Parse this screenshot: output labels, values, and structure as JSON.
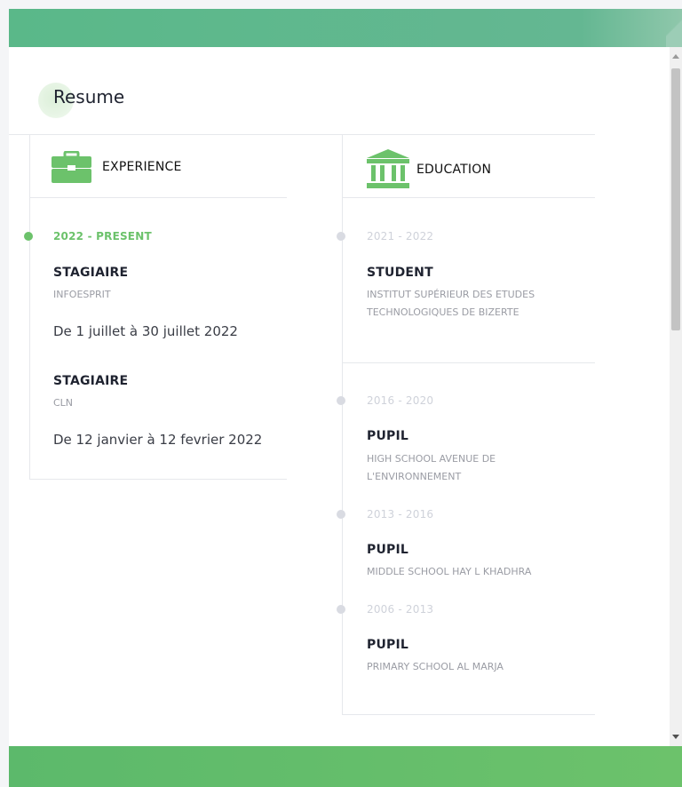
{
  "section_title": "Resume",
  "experience": {
    "heading": "EXPERIENCE",
    "icon": "briefcase-icon",
    "period": "2022 - PRESENT",
    "items": [
      {
        "role": "STAGIAIRE",
        "org": "INFOESPRIT",
        "desc": "De 1 juillet à 30 juillet 2022"
      },
      {
        "role": "STAGIAIRE",
        "org": "CLN",
        "desc": "De 12 janvier à 12 fevrier 2022"
      }
    ]
  },
  "education": {
    "heading": "EDUCATION",
    "icon": "institution-icon",
    "items": [
      {
        "period": "2021 - 2022",
        "role": "STUDENT",
        "org": "INSTITUT SUPÉRIEUR DES ETUDES TECHNOLOGIQUES DE BIZERTE"
      },
      {
        "period": "2016 - 2020",
        "role": "PUPIL",
        "org": "HIGH SCHOOL AVENUE DE L'ENVIRONNEMENT"
      },
      {
        "period": "2013 - 2016",
        "role": "PUPIL",
        "org": "MIDDLE SCHOOL HAY L KHADHRA"
      },
      {
        "period": "2006 - 2013",
        "role": "PUPIL",
        "org": "PRIMARY SCHOOL AL MARJA"
      }
    ]
  },
  "colors": {
    "accent": "#6cc26b",
    "header_bar": "#5ab889",
    "footer_bar": "#6cc26b",
    "muted_dot": "#d9dbe2"
  }
}
